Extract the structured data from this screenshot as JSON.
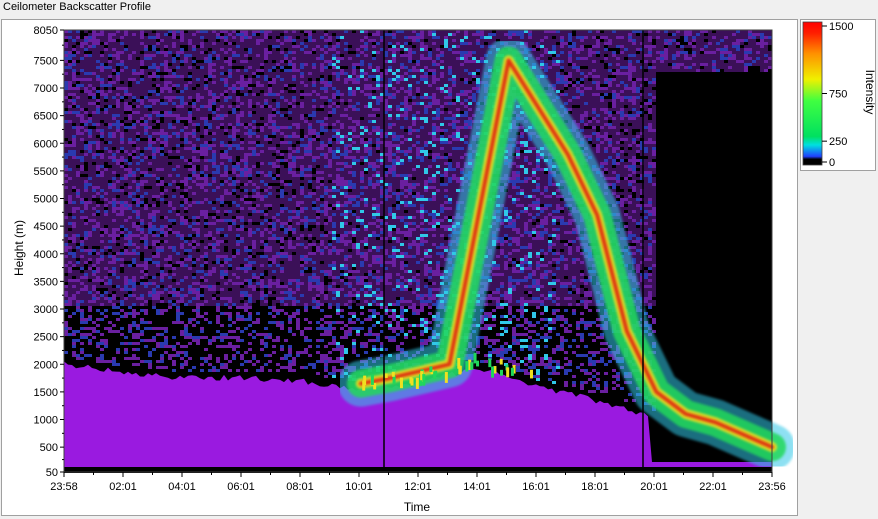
{
  "window": {
    "title": "Ceilometer Backscatter Profile"
  },
  "chart_data": {
    "type": "heatmap",
    "title": "Ceilometer Backscatter Profile",
    "xlabel": "Time",
    "ylabel": "Height (m)",
    "x_ticks": [
      "23:58",
      "02:01",
      "04:01",
      "06:01",
      "08:01",
      "10:01",
      "12:01",
      "14:01",
      "16:01",
      "18:01",
      "20:01",
      "22:01",
      "23:56"
    ],
    "y_ticks": [
      50,
      500,
      1000,
      1500,
      2000,
      2500,
      3000,
      3500,
      4000,
      4500,
      5000,
      5500,
      6000,
      6500,
      7000,
      7500,
      8050
    ],
    "ylim": [
      50,
      8050
    ],
    "colorbar": {
      "label": "Intensity",
      "ticks": [
        0,
        250,
        750,
        1500
      ],
      "range": [
        0,
        1500
      ]
    },
    "layers": {
      "boundary_layer_top_m": [
        2000,
        1850,
        1750,
        1760,
        1700,
        1550,
        1650,
        1950,
        1600,
        1350,
        1050,
        300,
        200
      ],
      "cloud_layer_profile": [
        {
          "time": "10:01",
          "height_m": 1650
        },
        {
          "time": "11:01",
          "height_m": 1750
        },
        {
          "time": "13:01",
          "height_m": 2000
        },
        {
          "time": "15:01",
          "height_m": 7500
        },
        {
          "time": "17:01",
          "height_m": 5800
        },
        {
          "time": "18:01",
          "height_m": 4700
        },
        {
          "time": "19:01",
          "height_m": 2600
        },
        {
          "time": "20:01",
          "height_m": 1500
        },
        {
          "time": "21:01",
          "height_m": 1100
        },
        {
          "time": "22:01",
          "height_m": 950
        },
        {
          "time": "23:56",
          "height_m": 500
        }
      ]
    },
    "colors": {
      "background_noise": "#3b1058",
      "boundary_layer": "#9a1ae0",
      "weak": "#30c8e8",
      "moderate": "#20d85a",
      "strong": "#f0e020",
      "peak": "#e02010"
    }
  }
}
